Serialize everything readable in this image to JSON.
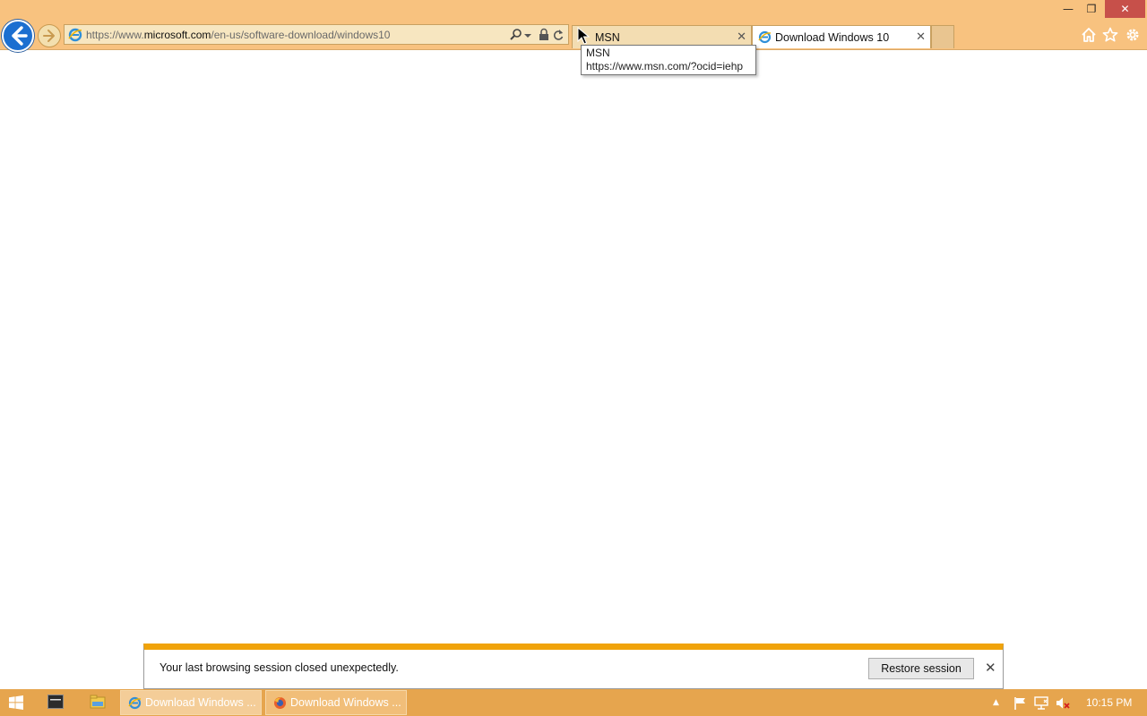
{
  "browser": {
    "address_bar": {
      "scheme": "https://www.",
      "host": "microsoft.com",
      "path": "/en-us/software-download/windows10"
    },
    "tabs": [
      {
        "label": "MSN",
        "active": false
      },
      {
        "label": "Download Windows 10",
        "active": true
      }
    ],
    "tooltip": {
      "title": "MSN",
      "url": "https://www.msn.com/?ocid=iehp"
    },
    "toolbar_icons": [
      "home-icon",
      "star-icon",
      "gear-icon"
    ],
    "window_controls": {
      "minimize": "—",
      "restore": "❐",
      "close": "✕"
    },
    "tab_close_glyph": "✕"
  },
  "notification": {
    "message": "Your last browsing session closed unexpectedly.",
    "restore_label": "Restore session",
    "close_glyph": "✕"
  },
  "taskbar": {
    "buttons": [
      {
        "label": "Download Windows ...",
        "app": "internet-explorer"
      },
      {
        "label": "Download Windows ...",
        "app": "firefox"
      }
    ],
    "tray": {
      "expand_glyph": "▲",
      "time": "10:15 PM"
    }
  },
  "colors": {
    "frame": "#f8c27f",
    "accent_notification": "#f0a30a",
    "back_button": "#1c6fd0",
    "close_button": "#c7504a",
    "taskbar": "#e6a54e"
  }
}
